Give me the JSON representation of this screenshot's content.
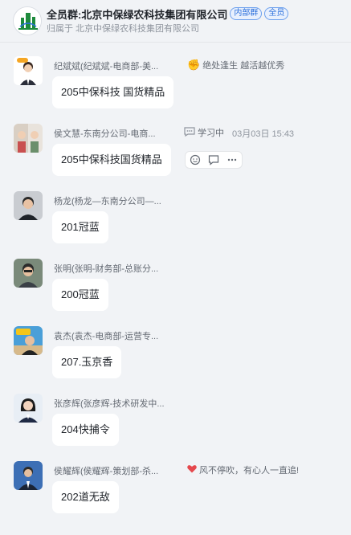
{
  "header": {
    "title": "全员群:北京中保绿农科技集团有限公司",
    "badge_internal": "内部群",
    "badge_all": "全员",
    "subtitle": "归属于 北京中保绿农科技集团有限公司"
  },
  "messages": [
    {
      "sender": "纪斌斌(纪斌斌-电商部-美...",
      "status_icon": "clap-hands-icon",
      "status": "绝处逢生 越活越优秀",
      "text": "205中保科技 国货精品"
    },
    {
      "sender": "侯文慧-东南分公司-电商...",
      "status_icon": "chat-bubble-icon",
      "status": "学习中",
      "time": "03月03日 15:43",
      "text": "205中保科技国货精品"
    },
    {
      "sender": "杨龙(杨龙—东南分公司—...",
      "text": "201冠蓝"
    },
    {
      "sender": "张明(张明-财务部-总账分...",
      "text": "200冠蓝"
    },
    {
      "sender": "袁杰(袁杰-电商部-运营专...",
      "text": "207.玉京香"
    },
    {
      "sender": "张彦辉(张彦辉-技术研发中...",
      "text": "204快捕令"
    },
    {
      "sender": "侯耀辉(侯耀辉-策划部-杀...",
      "status_icon": "heart-icon",
      "status": "风不停吹，有心人一直追!",
      "text": "202道无敌"
    }
  ],
  "colors": {
    "accent": "#2a6fdb",
    "background": "#f1f3f6",
    "bubble": "#ffffff",
    "heart": "#e5484d"
  }
}
